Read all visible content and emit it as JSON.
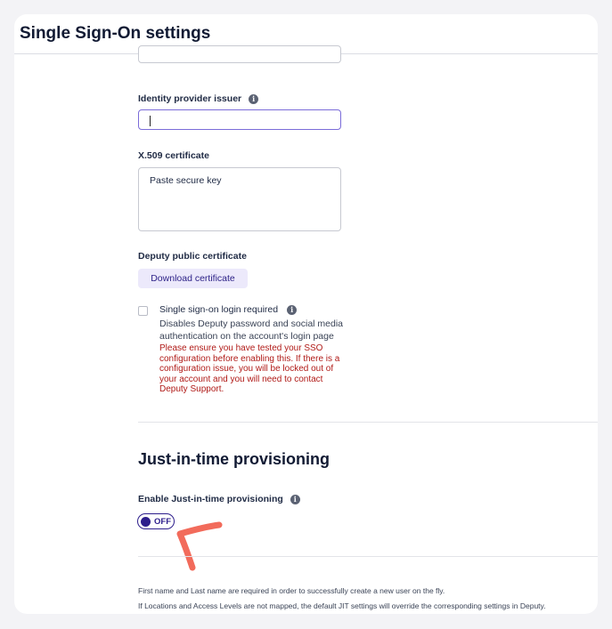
{
  "header": {
    "title": "Single Sign-On settings"
  },
  "form": {
    "idp_issuer_label": "Identity provider issuer",
    "x509_label": "X.509 certificate",
    "x509_placeholder": "Paste secure key",
    "public_cert_label": "Deputy public certificate",
    "download_button": "Download certificate",
    "sso_required": {
      "title": "Single sign-on login required",
      "description": "Disables Deputy password and social media authentication on the account's login page",
      "warning": "Please ensure you have tested your SSO configuration before enabling this. If there is a configuration issue, you will be locked out of your account and you will need to contact Deputy Support.",
      "checked": false
    }
  },
  "jit": {
    "section_title": "Just-in-time provisioning",
    "enable_label": "Enable Just-in-time provisioning",
    "toggle_state": "OFF",
    "notes": [
      "First name and Last name are required in order to successfully create a new user on the fly.",
      "If Locations and Access Levels are not mapped, the default JIT settings will override the corresponding settings in Deputy."
    ]
  },
  "icons": {
    "info": "info-icon"
  },
  "colors": {
    "accent": "#2d1e8c",
    "focus_border": "#7b6cd9",
    "warning": "#b01a17",
    "button_bg": "#ece9fb",
    "annotation": "#f26b5b"
  }
}
